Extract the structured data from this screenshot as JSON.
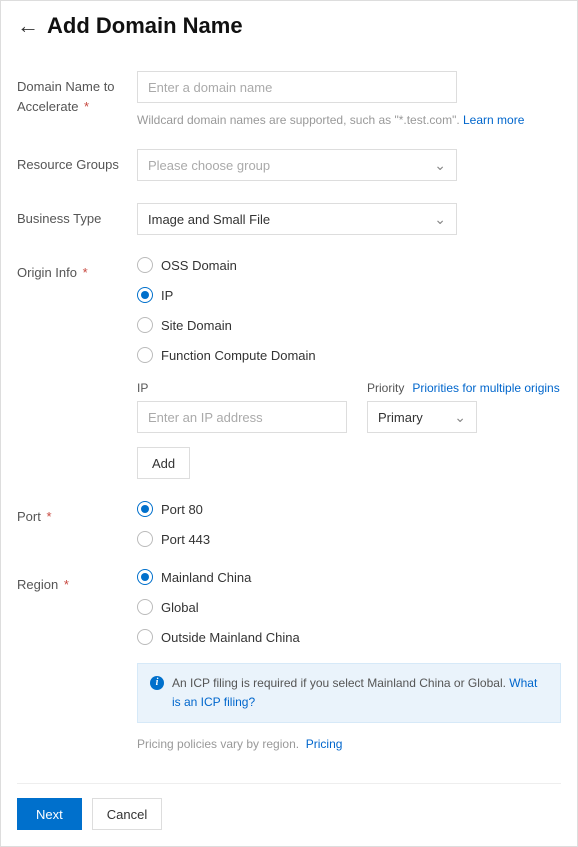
{
  "header": {
    "title": "Add Domain Name"
  },
  "domain": {
    "label": "Domain Name to Accelerate",
    "placeholder": "Enter a domain name",
    "hint_text": "Wildcard domain names are supported, such as \"*.test.com\". ",
    "hint_link": "Learn more"
  },
  "resource_groups": {
    "label": "Resource Groups",
    "placeholder": "Please choose group"
  },
  "business_type": {
    "label": "Business Type",
    "value": "Image and Small File"
  },
  "origin": {
    "label": "Origin Info",
    "options": [
      "OSS Domain",
      "IP",
      "Site Domain",
      "Function Compute Domain"
    ],
    "selected": "IP",
    "ip_label": "IP",
    "priority_label": "Priority",
    "priority_link": "Priorities for multiple origins",
    "ip_placeholder": "Enter an IP address",
    "priority_value": "Primary",
    "add_button": "Add"
  },
  "port": {
    "label": "Port",
    "options": [
      "Port 80",
      "Port 443"
    ],
    "selected": "Port 80"
  },
  "region": {
    "label": "Region",
    "options": [
      "Mainland China",
      "Global",
      "Outside Mainland China"
    ],
    "selected": "Mainland China",
    "info_text": "An ICP filing is required if you select Mainland China or Global. ",
    "info_link": "What is an ICP filing?",
    "pricing_text": "Pricing policies vary by region.",
    "pricing_link": "Pricing"
  },
  "footer": {
    "next": "Next",
    "cancel": "Cancel"
  }
}
